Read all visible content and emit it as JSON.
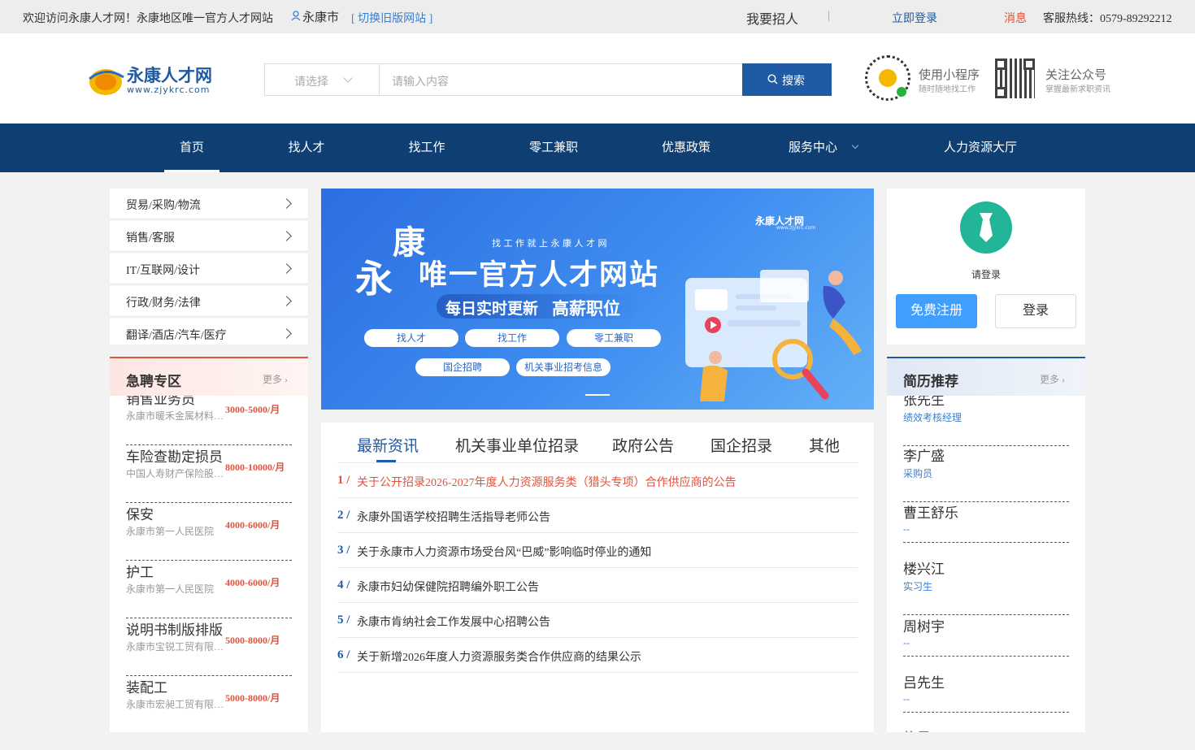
{
  "topbar": {
    "welcome": "欢迎访问永康人才网！永康地区唯一官方人才网站",
    "city": "永康市",
    "switch_old": "[ 切换旧版网站 ]",
    "recruit": "我要招人",
    "divider": "|",
    "login": "立即登录",
    "message": "消息",
    "hotline": "客服热线：0579-89292212"
  },
  "header": {
    "logo_text": "永康人才网",
    "logo_url": "www.zjykrc.com",
    "select_placeholder": "请选择",
    "search_placeholder": "请输入内容",
    "search_button": "搜索",
    "mini_program_title": "使用小程序",
    "mini_program_sub": "随时随地找工作",
    "official_title": "关注公众号",
    "official_sub": "掌握最新求职资讯"
  },
  "nav": {
    "items": [
      {
        "label": "首页"
      },
      {
        "label": "找人才"
      },
      {
        "label": "找工作"
      },
      {
        "label": "零工兼职"
      },
      {
        "label": "优惠政策"
      },
      {
        "label": "服务中心"
      },
      {
        "label": "人力资源大厅"
      }
    ]
  },
  "categories": [
    {
      "label": "贸易/采购/物流"
    },
    {
      "label": "销售/客服"
    },
    {
      "label": "IT/互联网/设计"
    },
    {
      "label": "行政/财务/法律"
    },
    {
      "label": "翻译/酒店/汽车/医疗"
    }
  ],
  "urgent": {
    "title": "急聘专区",
    "more": "更多",
    "jobs": [
      {
        "title": "销售业务员",
        "company": "永康市暖禾金属材料有限公司",
        "salary": "3000-5000/月"
      },
      {
        "title": "车险查勘定损员",
        "company": "中国人寿财产保险股份有限公司",
        "salary": "8000-10000/月"
      },
      {
        "title": "保安",
        "company": "永康市第一人民医院",
        "salary": "4000-6000/月"
      },
      {
        "title": "护工",
        "company": "永康市第一人民医院",
        "salary": "4000-6000/月"
      },
      {
        "title": "说明书制版排版",
        "company": "永康市宝锐工贸有限公司",
        "salary": "5000-8000/月"
      },
      {
        "title": "装配工",
        "company": "永康市宏昶工贸有限公司",
        "salary": "5000-8000/月"
      }
    ]
  },
  "banner": {
    "logo": "永康人才网",
    "logo_url": "www.zjykrc.com",
    "small_line": "找 工 作 就 上 永 康 人 才 网",
    "big_char1": "永",
    "big_char2": "康",
    "headline": "唯一官方人才网站",
    "sub_left": "每日实时更新",
    "sub_right": "高薪职位",
    "pills": [
      {
        "label": "找人才"
      },
      {
        "label": "找工作"
      },
      {
        "label": "零工兼职"
      },
      {
        "label": "国企招聘"
      },
      {
        "label": "机关事业招考信息"
      }
    ]
  },
  "news_tabs": [
    {
      "label": "最新资讯"
    },
    {
      "label": "机关事业单位招录"
    },
    {
      "label": "政府公告"
    },
    {
      "label": "国企招录"
    },
    {
      "label": "其他"
    }
  ],
  "news": [
    {
      "num": "1 /",
      "title": "关于公开招录2026-2027年度人力资源服务类（猎头专项）合作供应商的公告"
    },
    {
      "num": "2 /",
      "title": "永康外国语学校招聘生活指导老师公告"
    },
    {
      "num": "3 /",
      "title": "关于永康市人力资源市场受台风“巴威”影响临时停业的通知"
    },
    {
      "num": "4 /",
      "title": "永康市妇幼保健院招聘编外职工公告"
    },
    {
      "num": "5 /",
      "title": "永康市肯纳社会工作发展中心招聘公告"
    },
    {
      "num": "6 /",
      "title": "关于新增2026年度人力资源服务类合作供应商的结果公示"
    }
  ],
  "user": {
    "prompt": "请登录",
    "register": "免费注册",
    "login": "登录"
  },
  "resumes": {
    "title": "简历推荐",
    "more": "更多",
    "items": [
      {
        "name": "张先生",
        "position": "绩效考核经理"
      },
      {
        "name": "李广盛",
        "position": "采购员"
      },
      {
        "name": "曹王舒乐",
        "position": "--"
      },
      {
        "name": "楼兴江",
        "position": "实习生"
      },
      {
        "name": "周树宇",
        "position": "--"
      },
      {
        "name": "吕先生",
        "position": "--"
      },
      {
        "name": "施思",
        "position": "--"
      }
    ]
  },
  "colors": {
    "nav_bg": "#0f3e72",
    "accent_blue": "#1f5aa5",
    "salary_red": "#e0533d",
    "highlight_red": "#e0533d",
    "register_blue": "#409eff",
    "avatar_green": "#23b597"
  }
}
